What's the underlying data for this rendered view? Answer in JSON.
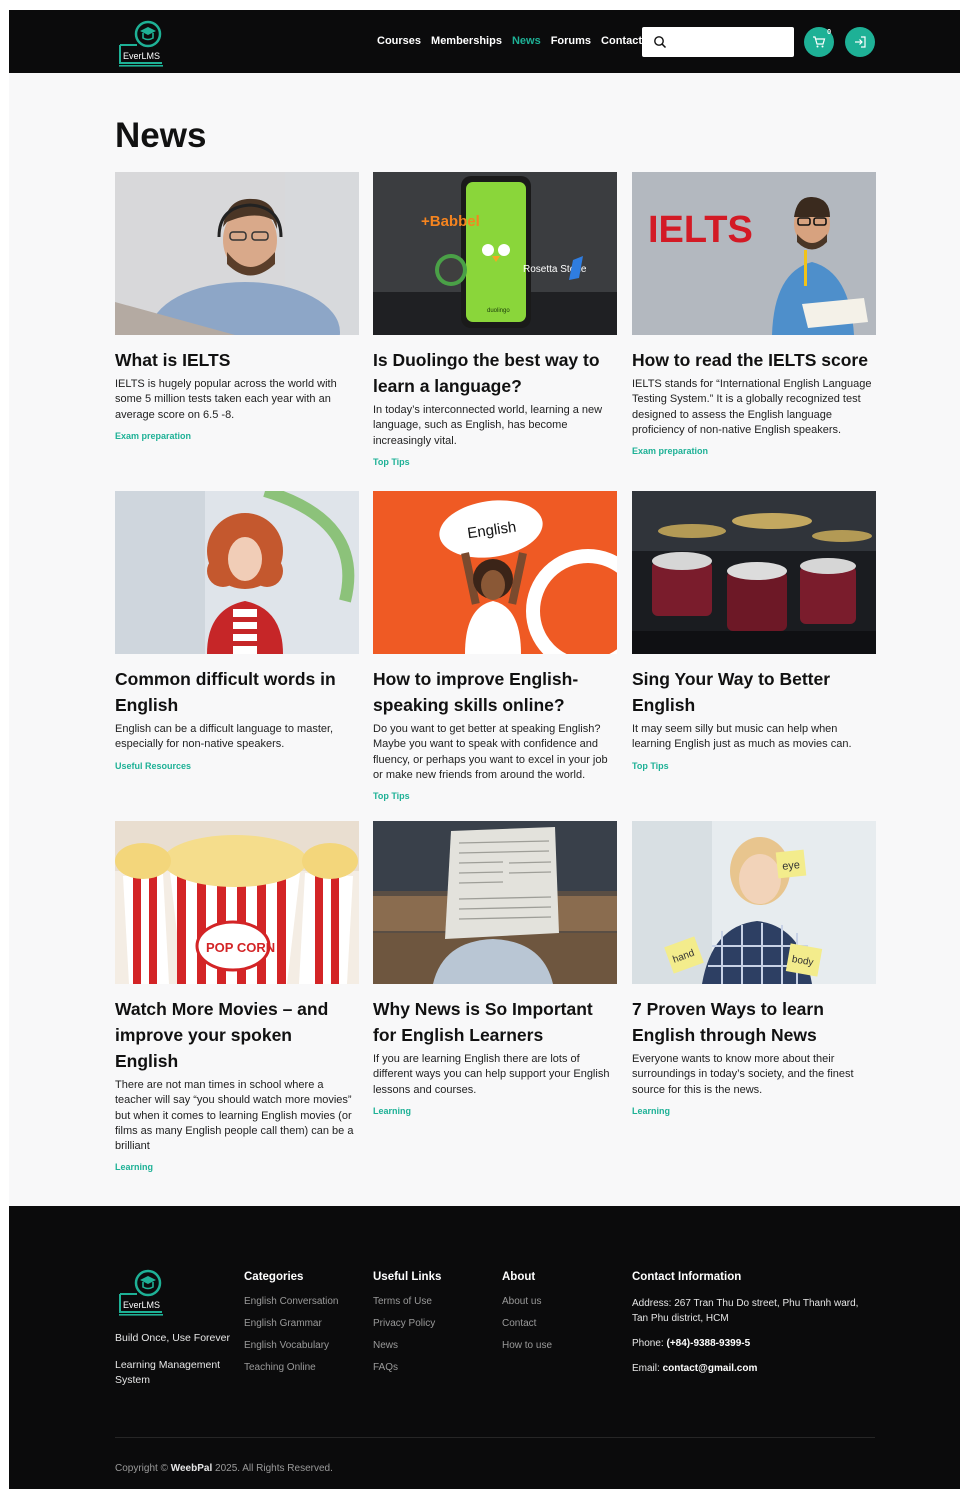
{
  "header": {
    "logo_text": "EverLMS",
    "nav": [
      "Courses",
      "Memberships",
      "News",
      "Forums",
      "Contact Us"
    ],
    "active_nav": "News",
    "search_placeholder": "",
    "cart_count": "0",
    "accent_color": "#1eb196"
  },
  "main": {
    "title": "News",
    "posts": [
      {
        "title": "What is IELTS",
        "excerpt": "IELTS is hugely popular across the world with some 5 million tests taken each year with an average score on 6.5 -8.",
        "category": "Exam preparation",
        "image": "man-with-headset-photo"
      },
      {
        "title": "Is Duolingo the best way to learn a language?",
        "excerpt": "In today’s interconnected world, learning a new language, such as English, has become increasingly vital.",
        "category": "Top Tips",
        "image": "phone-language-apps-photo",
        "image_text": {
          "babbel": "+Babbel",
          "rosetta": "Rosetta Stone",
          "phone": "duolingo"
        }
      },
      {
        "title": "How to read the IELTS score",
        "excerpt": "IELTS stands for “International English Language Testing System.” It is a globally recognized test designed to assess the English language proficiency of non-native English speakers.",
        "category": "Exam preparation",
        "image": "ielts-man-with-notebook-photo",
        "image_text": {
          "ielts": "IELTS"
        }
      },
      {
        "title": "Common difficult words in English",
        "excerpt": "English can be a difficult language to master, especially for non-native speakers.",
        "category": "Useful Resources",
        "image": "curly-hair-woman-photo"
      },
      {
        "title": "How to improve English-speaking skills online?",
        "excerpt": "Do you want to get better at speaking English? Maybe you want to speak with confidence and fluency, or perhaps you want to excel in your job or make new friends from around the world.",
        "category": "Top Tips",
        "image": "woman-holding-english-bubble-photo",
        "image_text": {
          "bubble": "English"
        }
      },
      {
        "title": "Sing Your Way to Better English",
        "excerpt": "It may seem silly but music can help when learning English just as much as movies can.",
        "category": "Top Tips",
        "image": "drum-kit-photo"
      },
      {
        "title": "Watch More Movies – and improve your spoken English",
        "excerpt": "There are not man times in school where a teacher will say “you should watch more movies” but when it comes to learning English movies (or films as many English people call them) can be a brilliant",
        "category": "Learning",
        "image": "popcorn-photo",
        "image_text": {
          "box": "POP CORN"
        }
      },
      {
        "title": "Why News is So Important for English Learners",
        "excerpt": "If you are learning English there are lots of different ways you can help support your English lessons and courses.",
        "category": "Learning",
        "image": "person-reading-newspaper-photo"
      },
      {
        "title": "7 Proven Ways to learn English through News",
        "excerpt": "Everyone wants to know more about their surroundings in today’s society, and the finest source for this is the news.",
        "category": "Learning",
        "image": "girl-with-sticky-notes-photo",
        "image_text": {
          "note1": "eye",
          "note2": "hand",
          "note3": "body"
        }
      }
    ]
  },
  "footer": {
    "logo_text": "EverLMS",
    "tagline": "Build Once, Use Forever",
    "description": "Learning Management System",
    "columns": [
      {
        "heading": "Categories",
        "links": [
          "English Conversation",
          "English Grammar",
          "English Vocabulary",
          "Teaching Online"
        ]
      },
      {
        "heading": "Useful Links",
        "links": [
          "Terms of Use",
          "Privacy Policy",
          "News",
          "FAQs"
        ]
      },
      {
        "heading": "About",
        "links": [
          "About us",
          "Contact",
          "How to use"
        ]
      }
    ],
    "contact": {
      "heading": "Contact Information",
      "address_label": "Address:",
      "address": "267 Tran Thu Do street, Phu Thanh ward, Tan Phu district, HCM",
      "phone_label": "Phone:",
      "phone": "(+84)-9388-9399-5",
      "email_label": "Email:",
      "email": "contact@gmail.com"
    },
    "copyright_prefix": "Copyright ©",
    "copyright_brand": "WeebPal",
    "copyright_suffix": "2025. All Rights Reserved."
  }
}
